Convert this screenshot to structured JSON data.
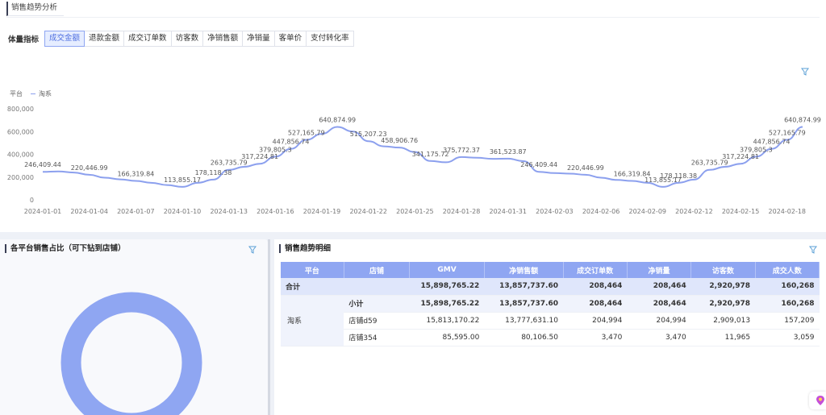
{
  "header": {
    "title": "销售趋势分析"
  },
  "metrics": {
    "label": "体量指标",
    "buttons": [
      "成交金额",
      "退款金额",
      "成交订单数",
      "访客数",
      "净销售额",
      "净销量",
      "客单价",
      "支付转化率"
    ],
    "active_index": 0
  },
  "legend": {
    "group": "平台",
    "series": "淘系"
  },
  "chart_data": {
    "type": "line",
    "x": [
      "2024-01-01",
      "2024-01-02",
      "2024-01-03",
      "2024-01-04",
      "2024-01-05",
      "2024-01-06",
      "2024-01-07",
      "2024-01-08",
      "2024-01-09",
      "2024-01-10",
      "2024-01-11",
      "2024-01-12",
      "2024-01-13",
      "2024-01-14",
      "2024-01-15",
      "2024-01-16",
      "2024-01-17",
      "2024-01-18",
      "2024-01-19",
      "2024-01-20",
      "2024-01-21",
      "2024-01-22",
      "2024-01-23",
      "2024-01-24",
      "2024-01-25",
      "2024-01-26",
      "2024-01-27",
      "2024-01-28",
      "2024-01-29",
      "2024-01-30",
      "2024-01-31",
      "2024-02-01",
      "2024-02-02",
      "2024-02-03",
      "2024-02-04",
      "2024-02-05",
      "2024-02-06",
      "2024-02-07",
      "2024-02-08",
      "2024-02-09",
      "2024-02-10",
      "2024-02-11",
      "2024-02-12",
      "2024-02-13",
      "2024-02-14",
      "2024-02-15",
      "2024-02-16",
      "2024-02-17",
      "2024-02-18",
      "2024-02-19"
    ],
    "tick_labels": [
      "2024-01-01",
      "2024-01-04",
      "2024-01-07",
      "2024-01-10",
      "2024-01-13",
      "2024-01-16",
      "2024-01-19",
      "2024-01-22",
      "2024-01-25",
      "2024-01-28",
      "2024-01-31",
      "2024-02-03",
      "2024-02-06",
      "2024-02-09",
      "2024-02-12",
      "2024-02-15",
      "2024-02-18"
    ],
    "series": [
      {
        "name": "淘系",
        "values": [
          246409.44,
          250000,
          240000,
          220446.99,
          195000,
          180000,
          166319.84,
          150000,
          130000,
          113855.17,
          150000,
          178118.38,
          263735.79,
          290000,
          317224.81,
          379805.3,
          447856.74,
          527165.79,
          580000,
          640874.99,
          600000,
          515207.23,
          470000,
          458906.76,
          420000,
          341175.72,
          330000,
          375772.37,
          370000,
          360000,
          361523.87,
          340000,
          246409.44,
          235000,
          230000,
          220446.99,
          195000,
          175000,
          166319.84,
          150000,
          113855.17,
          150000,
          178118.38,
          263735.79,
          290000,
          317224.81,
          379805.3,
          447856.74,
          527165.79,
          640874.99
        ],
        "labels": {
          "0": "246,409.44",
          "3": "220,446.99",
          "6": "166,319.84",
          "9": "113,855.17",
          "11": "178,118.38",
          "12": "263,735.79",
          "14": "317,224.81",
          "15": "379,805.3",
          "16": "447,856.74",
          "17": "527,165.79",
          "19": "640,874.99",
          "21": "515,207.23",
          "23": "458,906.76",
          "25": "341,175.72",
          "27": "375,772.37",
          "30": "361,523.87",
          "32": "246,409.44",
          "35": "220,446.99",
          "38": "166,319.84",
          "40": "113,855.17",
          "41": "178,118.38",
          "43": "263,735.79",
          "45": "317,224.81",
          "46": "379,805.3",
          "47": "447,856.74",
          "48": "527,165.79",
          "49": "640,874.99"
        }
      }
    ],
    "ylim": [
      0,
      800000
    ],
    "yticks": [
      "0",
      "200,000",
      "400,000",
      "600,000",
      "800,000"
    ],
    "grid": false,
    "color": "#8ca0ee"
  },
  "left_panel": {
    "title": "各平台销售占比（可下钻到店铺）",
    "ring_color": "#8fa6f2"
  },
  "right_panel": {
    "title": "销售趋势明细",
    "columns": [
      "平台",
      "店铺",
      "GMV",
      "净销售额",
      "成交订单数",
      "净销量",
      "访客数",
      "成交人数"
    ],
    "total_row": {
      "label": "合计",
      "values": [
        "15,898,765.22",
        "13,857,737.60",
        "208,464",
        "208,464",
        "2,920,978",
        "160,268"
      ]
    },
    "platform": "淘系",
    "subtotal_row": {
      "label": "小计",
      "values": [
        "15,898,765.22",
        "13,857,737.60",
        "208,464",
        "208,464",
        "2,920,978",
        "160,268"
      ]
    },
    "rows": [
      {
        "store": "店铺d59",
        "values": [
          "15,813,170.22",
          "13,777,631.10",
          "204,994",
          "204,994",
          "2,909,013",
          "157,209"
        ]
      },
      {
        "store": "店铺354",
        "values": [
          "85,595.00",
          "80,106.50",
          "3,470",
          "3,470",
          "11,965",
          "3,059"
        ]
      }
    ]
  }
}
